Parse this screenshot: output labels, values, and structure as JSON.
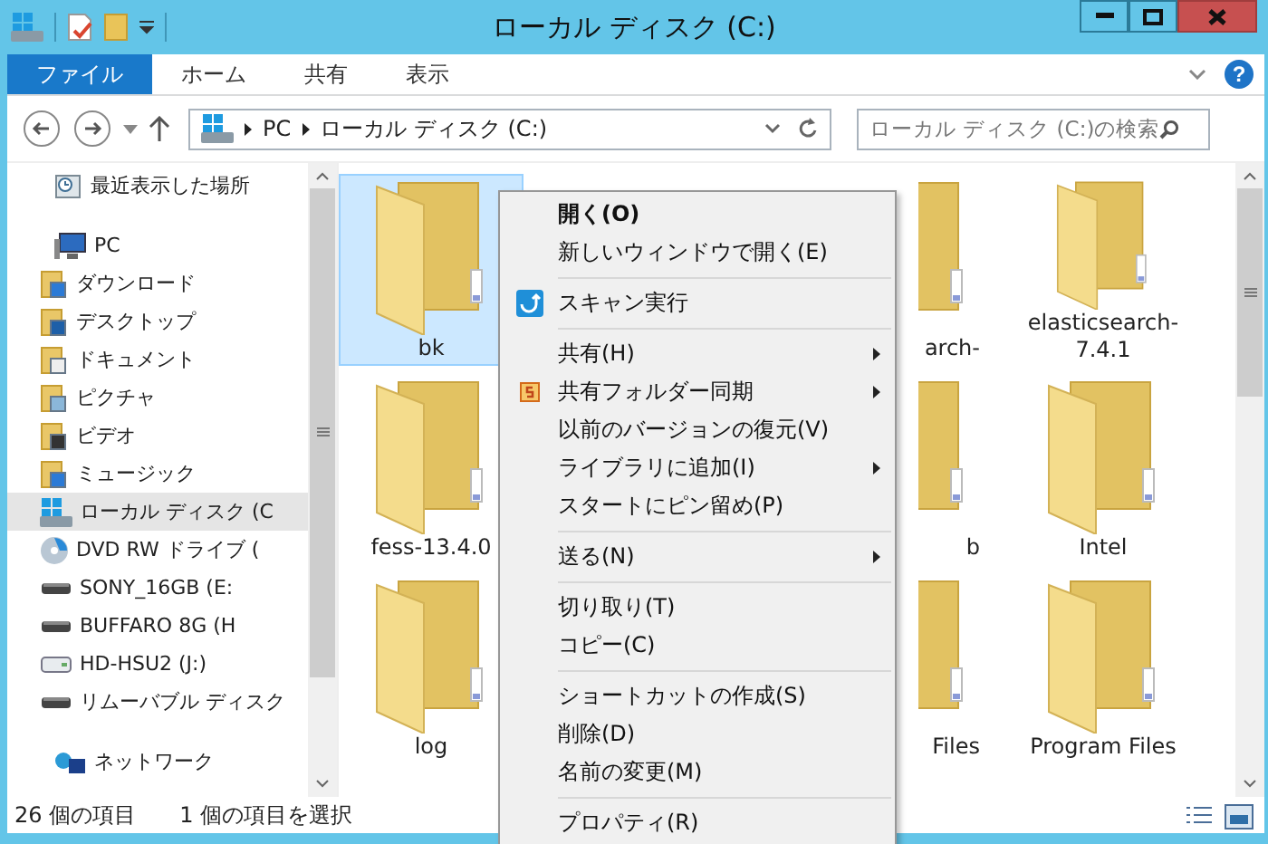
{
  "window": {
    "title": "ローカル ディスク (C:)"
  },
  "ribbon": {
    "tabs": [
      {
        "label": "ファイル",
        "selected": true
      },
      {
        "label": "ホーム",
        "selected": false
      },
      {
        "label": "共有",
        "selected": false
      },
      {
        "label": "表示",
        "selected": false
      }
    ],
    "help": "?"
  },
  "address_bar": {
    "path": [
      "PC",
      "ローカル ディスク (C:)"
    ]
  },
  "search": {
    "placeholder": "ローカル ディスク (C:)の検索"
  },
  "sidebar": {
    "items": [
      {
        "label": "最近表示した場所",
        "kind": "recent",
        "selected": false
      },
      {
        "label": "PC",
        "kind": "pc",
        "selected": false,
        "children": [
          {
            "label": "ダウンロード",
            "kind": "downloads",
            "selected": false
          },
          {
            "label": "デスクトップ",
            "kind": "desktop",
            "selected": false
          },
          {
            "label": "ドキュメント",
            "kind": "documents",
            "selected": false
          },
          {
            "label": "ピクチャ",
            "kind": "pictures",
            "selected": false
          },
          {
            "label": "ビデオ",
            "kind": "videos",
            "selected": false
          },
          {
            "label": "ミュージック",
            "kind": "music",
            "selected": false
          },
          {
            "label": "ローカル ディスク (C",
            "kind": "disk",
            "selected": true
          },
          {
            "label": "DVD RW ドライブ (",
            "kind": "dvd",
            "selected": false
          },
          {
            "label": "SONY_16GB (E:",
            "kind": "drive",
            "selected": false
          },
          {
            "label": "BUFFARO 8G (H",
            "kind": "drive",
            "selected": false
          },
          {
            "label": "HD-HSU2 (J:)",
            "kind": "hdd",
            "selected": false
          },
          {
            "label": "リムーバブル ディスク",
            "kind": "drive",
            "selected": false
          }
        ]
      },
      {
        "label": "ネットワーク",
        "kind": "network",
        "selected": false
      }
    ]
  },
  "folders": [
    {
      "label": "bk",
      "selected": true
    },
    {
      "label": "arch-",
      "selected": false
    },
    {
      "label": "elasticsearch-7.4.1",
      "selected": false
    },
    {
      "label": "fess-13.4.0",
      "selected": false
    },
    {
      "label": "b",
      "selected": false
    },
    {
      "label": "Intel",
      "selected": false
    },
    {
      "label": "log",
      "selected": false
    },
    {
      "label": "Files",
      "selected": false
    },
    {
      "label": "Program Files",
      "selected": false
    }
  ],
  "context_menu": [
    {
      "kind": "item",
      "label": "開く(O)",
      "bold": true,
      "submenu": false
    },
    {
      "kind": "item",
      "label": "新しいウィンドウで開く(E)",
      "bold": false,
      "submenu": false
    },
    {
      "kind": "separator"
    },
    {
      "kind": "item",
      "label": "スキャン実行",
      "bold": false,
      "submenu": false
    },
    {
      "kind": "separator"
    },
    {
      "kind": "item",
      "label": "共有(H)",
      "bold": false,
      "submenu": true
    },
    {
      "kind": "item",
      "label": "共有フォルダー同期",
      "bold": false,
      "submenu": true
    },
    {
      "kind": "item",
      "label": "以前のバージョンの復元(V)",
      "bold": false,
      "submenu": false
    },
    {
      "kind": "item",
      "label": "ライブラリに追加(I)",
      "bold": false,
      "submenu": true
    },
    {
      "kind": "item",
      "label": "スタートにピン留め(P)",
      "bold": false,
      "submenu": false
    },
    {
      "kind": "separator"
    },
    {
      "kind": "item",
      "label": "送る(N)",
      "bold": false,
      "submenu": true
    },
    {
      "kind": "separator"
    },
    {
      "kind": "item",
      "label": "切り取り(T)",
      "bold": false,
      "submenu": false
    },
    {
      "kind": "item",
      "label": "コピー(C)",
      "bold": false,
      "submenu": false
    },
    {
      "kind": "separator"
    },
    {
      "kind": "item",
      "label": "ショートカットの作成(S)",
      "bold": false,
      "submenu": false
    },
    {
      "kind": "item",
      "label": "削除(D)",
      "bold": false,
      "submenu": false
    },
    {
      "kind": "item",
      "label": "名前の変更(M)",
      "bold": false,
      "submenu": false
    },
    {
      "kind": "separator"
    },
    {
      "kind": "item",
      "label": "プロパティ(R)",
      "bold": false,
      "submenu": false
    }
  ],
  "status_bar": {
    "item_count": "26 個の項目",
    "selection": "1 個の項目を選択"
  }
}
